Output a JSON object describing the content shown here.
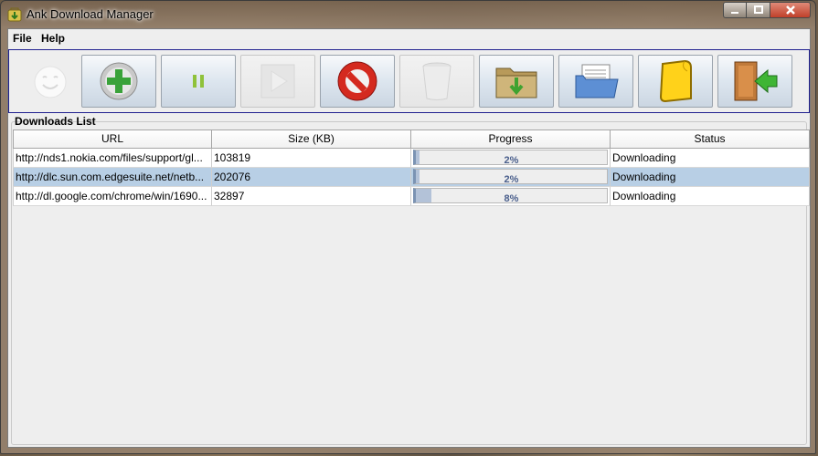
{
  "window": {
    "title": "Ank Download Manager"
  },
  "menu": {
    "file": "File",
    "help": "Help"
  },
  "section": {
    "title": "Downloads List"
  },
  "table": {
    "columns": [
      "URL",
      "Size (KB)",
      "Progress",
      "Status"
    ],
    "rows": [
      {
        "url": "http://nds1.nokia.com/files/support/gl...",
        "size": "103819",
        "progress_text": "2%",
        "progress": 0.02,
        "status": "Downloading"
      },
      {
        "url": "http://dlc.sun.com.edgesuite.net/netb...",
        "size": "202076",
        "progress_text": "2%",
        "progress": 0.02,
        "status": "Downloading"
      },
      {
        "url": "http://dl.google.com/chrome/win/1690...",
        "size": "32897",
        "progress_text": "8%",
        "progress": 0.08,
        "status": "Downloading"
      }
    ]
  },
  "toolbar": {
    "icons": [
      "add-download-icon",
      "pause-icon",
      "resume-icon",
      "cancel-icon",
      "clear-icon",
      "open-download-folder-icon",
      "open-folder-icon",
      "note-icon",
      "exit-icon"
    ]
  },
  "colors": {
    "selected_row": "#b8cfe5",
    "progress_text": "#4a5f8c",
    "toolbar_border": "#1f1f8f"
  }
}
